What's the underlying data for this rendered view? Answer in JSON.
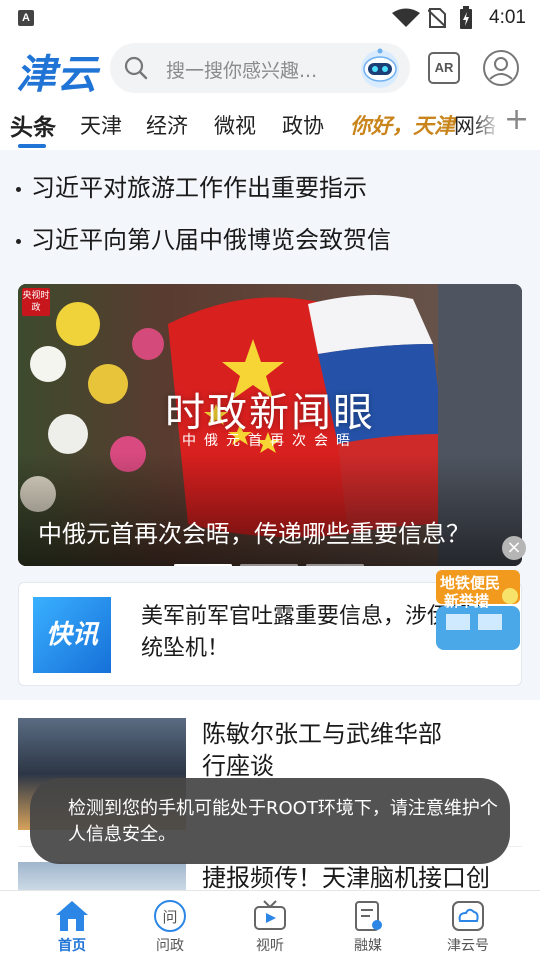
{
  "status_bar": {
    "carrier_icon": "A",
    "time": "4:01"
  },
  "header": {
    "logo": "津云",
    "search_placeholder": "搜一搜你感兴趣...",
    "ar_label": "AR"
  },
  "tabs": [
    {
      "label": "头条",
      "active": true
    },
    {
      "label": "天津"
    },
    {
      "label": "经济"
    },
    {
      "label": "微视"
    },
    {
      "label": "政协"
    },
    {
      "label": "你好，天津"
    },
    {
      "label": "网络"
    }
  ],
  "headlines": [
    "习近平对旅游工作作出重要指示",
    "习近平向第八届中俄博览会致贺信"
  ],
  "banner": {
    "badge": "央视时政",
    "center_title": "时政新闻眼",
    "center_subtitle": "中俄元首再次会晤",
    "caption": "中俄元首再次会晤，传递哪些重要信息？"
  },
  "kuaixun": {
    "logo": "快讯",
    "text": "美军前军官吐露重要信息，涉伊朗总统坠机！"
  },
  "news": [
    {
      "title": "陈敏尔张工与武维华部行座谈"
    },
    {
      "title": "捷报频传！天津脑机接口创"
    }
  ],
  "promo": {
    "line1": "地铁便民",
    "line2": "新举措"
  },
  "toast": "检测到您的手机可能处于ROOT环境下，请注意维护个人信息安全。",
  "bottom_nav": [
    {
      "label": "首页",
      "active": true
    },
    {
      "label": "问政"
    },
    {
      "label": "视听"
    },
    {
      "label": "融媒"
    },
    {
      "label": "津云号"
    }
  ],
  "colors": {
    "accent": "#1f74d6",
    "toast_bg": "#464646"
  }
}
